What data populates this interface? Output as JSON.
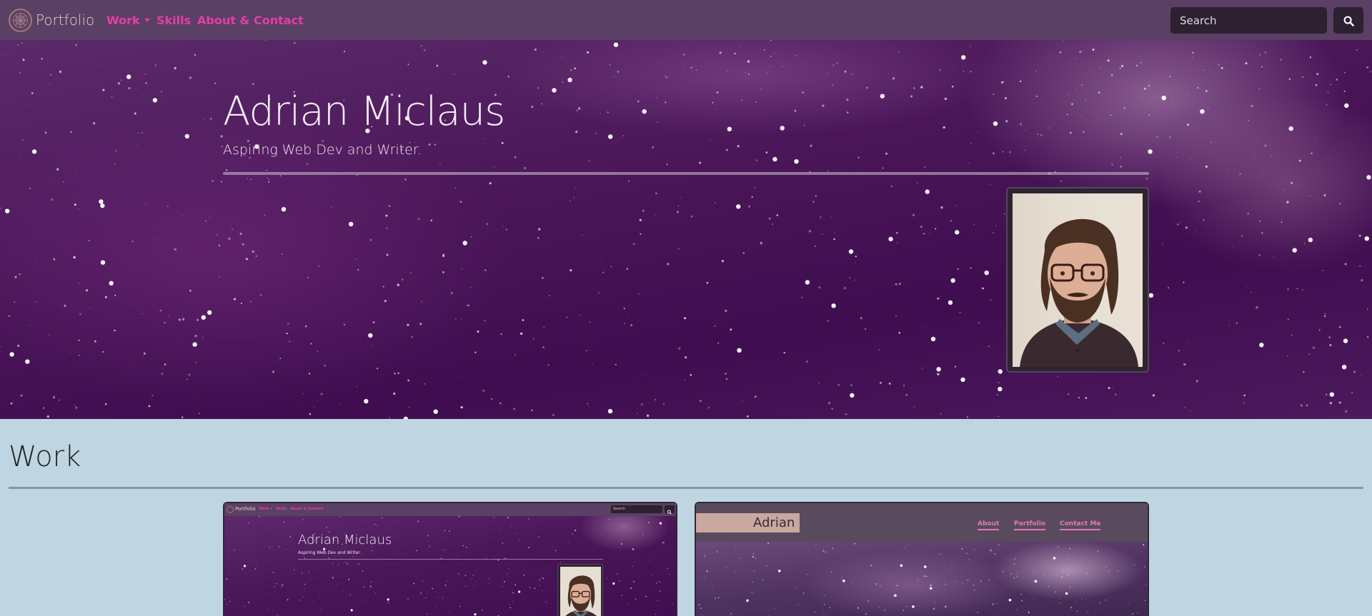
{
  "navbar": {
    "brand": "Portfolio",
    "links": [
      {
        "label": "Work",
        "has_dropdown": true
      },
      {
        "label": "Skills"
      },
      {
        "label": "About & Contact"
      }
    ],
    "search_placeholder": "Search",
    "search_icon": "search-icon"
  },
  "hero": {
    "title": "Adrian Miclaus",
    "subtitle": "Aspiring Web Dev and Writer."
  },
  "work": {
    "heading": "Work",
    "cards": [
      {
        "mini": {
          "brand": "Portfolio",
          "links": [
            "Work ▾",
            "Skills",
            "About & Contact"
          ],
          "search_placeholder": "Search",
          "title": "Adrian Miclaus",
          "subtitle": "Aspiring Web Dev and Writer."
        }
      },
      {
        "mini": {
          "name": "Adrian",
          "links": [
            "About",
            "Portfolio",
            "Contact Me"
          ]
        }
      }
    ]
  },
  "colors": {
    "navbar_bg": "#5a4064",
    "accent_link": "#e53da6",
    "page_bg": "#bfd6e2",
    "search_bg": "#2d2030"
  }
}
